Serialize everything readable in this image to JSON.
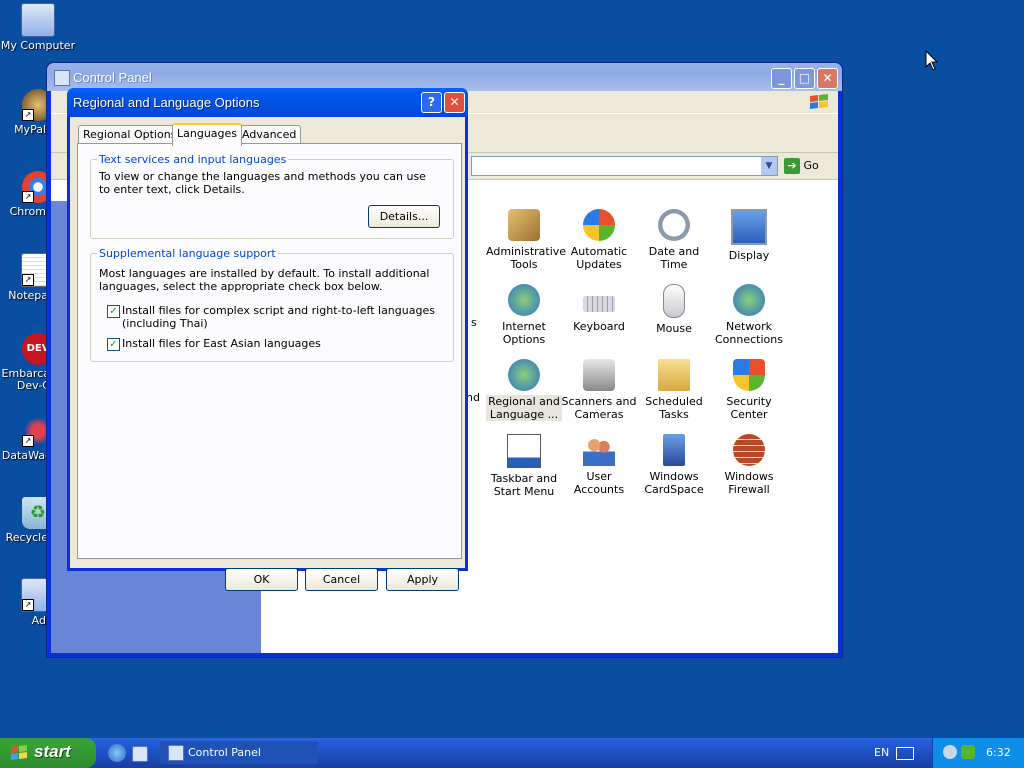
{
  "desktop": {
    "icons": [
      {
        "label": "My Computer",
        "icon": "my-computer-icon"
      },
      {
        "label": "MyPal",
        "icon": "mypal-icon"
      },
      {
        "label": "Chrom",
        "icon": "chrome-icon"
      },
      {
        "label": "Notepa",
        "icon": "notepad-icon"
      },
      {
        "label": "Embarca\nDev-C",
        "icon": "embarcadero-devc-icon"
      },
      {
        "label": "DataWag",
        "icon": "datawag-icon"
      },
      {
        "label": "Recycle",
        "icon": "recycle-bin-icon"
      },
      {
        "label": "Ad",
        "icon": "ad-icon"
      }
    ]
  },
  "control_panel": {
    "title": "Control Panel",
    "go_label": "Go",
    "side_fragments": {
      "r1": "s",
      "r2": "nd"
    },
    "items": [
      {
        "label": "Administrative Tools",
        "icon": "administrative-tools-icon"
      },
      {
        "label": "Automatic Updates",
        "icon": "automatic-updates-icon"
      },
      {
        "label": "Date and Time",
        "icon": "date-time-icon"
      },
      {
        "label": "Display",
        "icon": "display-icon"
      },
      {
        "label": "Internet Options",
        "icon": "internet-options-icon"
      },
      {
        "label": "Keyboard",
        "icon": "keyboard-icon"
      },
      {
        "label": "Mouse",
        "icon": "mouse-icon"
      },
      {
        "label": "Network Connections",
        "icon": "network-connections-icon"
      },
      {
        "label": "Regional and Language ...",
        "icon": "regional-language-icon",
        "selected": true
      },
      {
        "label": "Scanners and Cameras",
        "icon": "scanners-cameras-icon"
      },
      {
        "label": "Scheduled Tasks",
        "icon": "scheduled-tasks-icon"
      },
      {
        "label": "Security Center",
        "icon": "security-center-icon"
      },
      {
        "label": "Taskbar and Start Menu",
        "icon": "taskbar-start-menu-icon"
      },
      {
        "label": "User Accounts",
        "icon": "user-accounts-icon"
      },
      {
        "label": "Windows CardSpace",
        "icon": "windows-cardspace-icon"
      },
      {
        "label": "Windows Firewall",
        "icon": "windows-firewall-icon"
      }
    ]
  },
  "dialog": {
    "title": "Regional and Language Options",
    "tabs": [
      "Regional Options",
      "Languages",
      "Advanced"
    ],
    "active_tab": "Languages",
    "text_services": {
      "group_label": "Text services and input languages",
      "description": "To view or change the languages and methods you can use to enter text, click Details.",
      "details_button": "Details..."
    },
    "supplemental": {
      "group_label": "Supplemental language support",
      "description": "Most languages are installed by default. To install additional languages, select the appropriate check box below.",
      "complex_script_label": "Install files for complex script and right-to-left languages (including Thai)",
      "complex_script_checked": true,
      "east_asian_label": "Install files for East Asian languages",
      "east_asian_checked": true
    },
    "buttons": {
      "ok": "OK",
      "cancel": "Cancel",
      "apply": "Apply"
    }
  },
  "taskbar": {
    "start_label": "start",
    "task_label": "Control Panel",
    "language": "EN",
    "clock": "6:32"
  },
  "colors": {
    "desktop": "#0a4ea2",
    "title_active": "#0054e3",
    "title_inactive": "#98b2e8",
    "dialog_bg": "#ece9d8",
    "group_label": "#0046d5",
    "start_green": "#36a336"
  }
}
